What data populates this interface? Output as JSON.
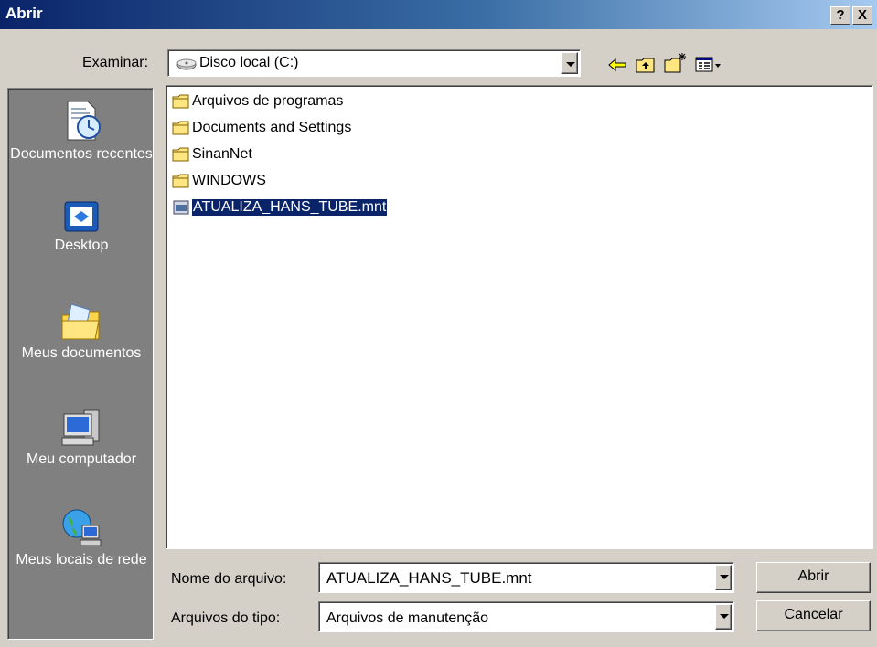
{
  "window": {
    "title": "Abrir",
    "help_button": "?",
    "close_button": "X"
  },
  "toolbar": {
    "look_in_label": "Examinar:",
    "look_in_value": "Disco local (C:)",
    "icons": [
      "back-arrow-icon",
      "up-folder-icon",
      "new-folder-icon",
      "view-menu-icon"
    ]
  },
  "places": [
    {
      "label": "Documentos recentes",
      "icon": "recent-documents-icon"
    },
    {
      "label": "Desktop",
      "icon": "desktop-icon"
    },
    {
      "label": "Meus documentos",
      "icon": "my-documents-icon"
    },
    {
      "label": "Meu computador",
      "icon": "my-computer-icon"
    },
    {
      "label": "Meus locais de rede",
      "icon": "network-places-icon"
    }
  ],
  "files": [
    {
      "name": "Arquivos de programas",
      "type": "folder"
    },
    {
      "name": "Documents and Settings",
      "type": "folder"
    },
    {
      "name": "SinanNet",
      "type": "folder"
    },
    {
      "name": "WINDOWS",
      "type": "folder"
    },
    {
      "name": "ATUALIZA_HANS_TUBE.mnt",
      "type": "file",
      "selected": true
    }
  ],
  "filename": {
    "label": "Nome do arquivo:",
    "value": "ATUALIZA_HANS_TUBE.mnt"
  },
  "filetype": {
    "label": "Arquivos do tipo:",
    "value": "Arquivos de manutenção"
  },
  "buttons": {
    "open": "Abrir",
    "cancel": "Cancelar"
  },
  "colors": {
    "title_bar": "#0a246a",
    "selection": "#0a246a",
    "places_bg": "#808080",
    "dialog_bg": "#d4d0c8"
  }
}
